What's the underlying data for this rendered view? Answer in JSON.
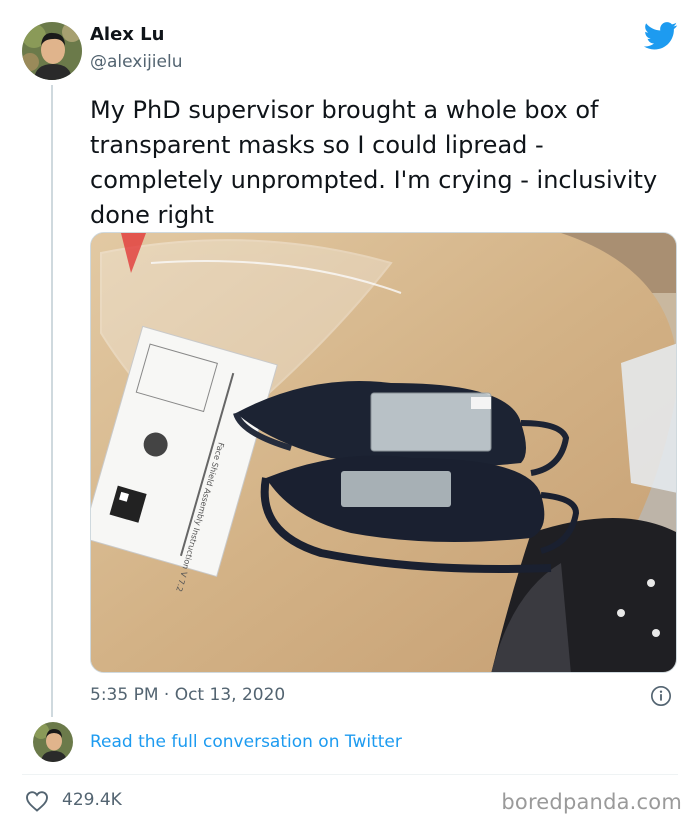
{
  "author": {
    "name": "Alex Lu",
    "handle": "@alexijielu"
  },
  "tweet": {
    "text": "My PhD supervisor brought a whole box of transparent masks so I could lipread - completely unprompted. I'm crying - inclusivity done right",
    "timestamp": "5:35 PM · Oct 13, 2020",
    "likes": "429.4K"
  },
  "actions": {
    "read_conversation": "Read the full conversation on Twitter"
  },
  "photo": {
    "shield_label": "Face Shield Assembly Instruction V 7.2"
  },
  "watermark": "boredpanda.com",
  "colors": {
    "twitter_blue": "#1d9bf0",
    "text_primary": "#0f1419",
    "text_secondary": "#536471",
    "heart_outline": "#536471"
  },
  "icons": {
    "logo": "twitter-bird-icon",
    "info": "info-icon",
    "like": "heart-icon"
  }
}
